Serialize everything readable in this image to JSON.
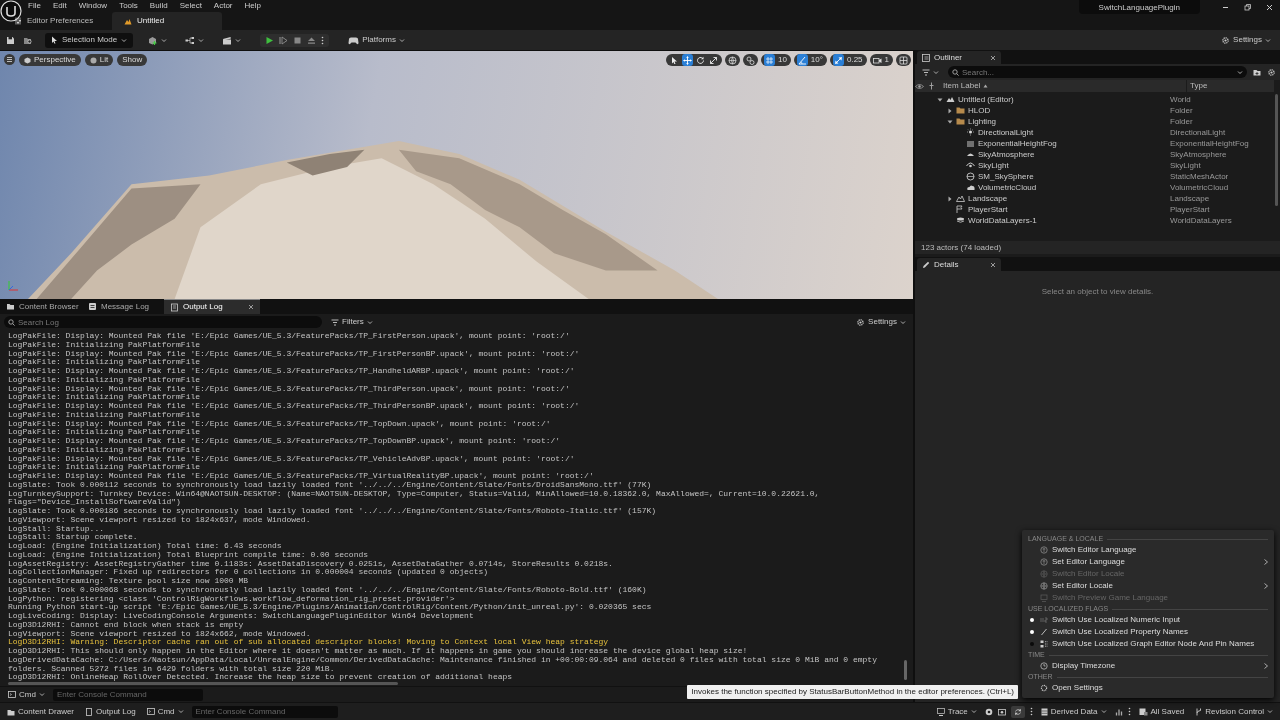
{
  "app": {
    "menus": [
      "File",
      "Edit",
      "Window",
      "Tools",
      "Build",
      "Select",
      "Actor",
      "Help"
    ],
    "tabs": [
      {
        "label": "Editor Preferences",
        "kind": "preferences",
        "selected": false
      },
      {
        "label": "Untitled",
        "kind": "level",
        "selected": true
      }
    ],
    "project": "SwitchLanguagePlugin"
  },
  "toolbar": {
    "mode": "Selection Mode",
    "platforms": "Platforms",
    "settings": "Settings"
  },
  "viewport": {
    "view": "Perspective",
    "lighting": "Lit",
    "show": "Show",
    "tools": [
      {
        "kind": "select",
        "selected": false
      },
      {
        "kind": "move",
        "selected": true
      },
      {
        "kind": "rotate",
        "selected": false
      },
      {
        "kind": "scale",
        "selected": false
      }
    ],
    "grid_snap": "10",
    "angle_snap": "10°",
    "scale_snap": "0.25",
    "camera_speed": "1"
  },
  "outliner": {
    "tab": "Outliner",
    "search": {
      "placeholder": "Search..."
    },
    "columns": [
      "Item Label",
      "Type"
    ],
    "items": [
      {
        "label": "Untitled (Editor)",
        "type": "World",
        "kind": "world",
        "expanded": true,
        "children": [
          {
            "label": "HLOD",
            "type": "Folder",
            "kind": "folder",
            "expanded": false
          },
          {
            "label": "Lighting",
            "type": "Folder",
            "kind": "folder",
            "expanded": true,
            "children": [
              {
                "label": "DirectionalLight",
                "type": "DirectionalLight",
                "kind": "light"
              },
              {
                "label": "ExponentialHeightFog",
                "type": "ExponentialHeightFog",
                "kind": "fog"
              },
              {
                "label": "SkyAtmosphere",
                "type": "SkyAtmosphere",
                "kind": "atmosphere"
              },
              {
                "label": "SkyLight",
                "type": "SkyLight",
                "kind": "skylight"
              },
              {
                "label": "SM_SkySphere",
                "type": "StaticMeshActor",
                "kind": "mesh"
              },
              {
                "label": "VolumetricCloud",
                "type": "VolumetricCloud",
                "kind": "cloud"
              }
            ]
          },
          {
            "label": "Landscape",
            "type": "Landscape",
            "kind": "landscape",
            "expanded": false
          },
          {
            "label": "PlayerStart",
            "type": "PlayerStart",
            "kind": "playerstart"
          },
          {
            "label": "WorldDataLayers-1",
            "type": "WorldDataLayers",
            "kind": "datalayers"
          }
        ]
      }
    ],
    "footer": "123 actors (74 loaded)"
  },
  "details": {
    "tab": "Details",
    "empty_text": "Select an object to view details."
  },
  "bottom_panel": {
    "tabs": [
      {
        "label": "Content Browser",
        "kind": "content",
        "selected": false
      },
      {
        "label": "Message Log",
        "kind": "message",
        "selected": false
      },
      {
        "label": "Output Log",
        "kind": "output",
        "selected": true
      }
    ],
    "search": {
      "placeholder": "Search Log"
    },
    "filters": "Filters",
    "settings": "Settings",
    "lines": [
      {
        "text": "LogPakFile: Display: Mounted Pak file 'E:/Epic Games/UE_5.3/FeaturePacks/TP_FirstPerson.upack', mount point: 'root:/'",
        "kind": "info"
      },
      {
        "text": "LogPakFile: Initializing PakPlatformFile",
        "kind": "info"
      },
      {
        "text": "LogPakFile: Display: Mounted Pak file 'E:/Epic Games/UE_5.3/FeaturePacks/TP_FirstPersonBP.upack', mount point: 'root:/'",
        "kind": "info"
      },
      {
        "text": "LogPakFile: Initializing PakPlatformFile",
        "kind": "info"
      },
      {
        "text": "LogPakFile: Display: Mounted Pak file 'E:/Epic Games/UE_5.3/FeaturePacks/TP_HandheldARBP.upack', mount point: 'root:/'",
        "kind": "info"
      },
      {
        "text": "LogPakFile: Initializing PakPlatformFile",
        "kind": "info"
      },
      {
        "text": "LogPakFile: Display: Mounted Pak file 'E:/Epic Games/UE_5.3/FeaturePacks/TP_ThirdPerson.upack', mount point: 'root:/'",
        "kind": "info"
      },
      {
        "text": "LogPakFile: Initializing PakPlatformFile",
        "kind": "info"
      },
      {
        "text": "LogPakFile: Display: Mounted Pak file 'E:/Epic Games/UE_5.3/FeaturePacks/TP_ThirdPersonBP.upack', mount point: 'root:/'",
        "kind": "info"
      },
      {
        "text": "LogPakFile: Initializing PakPlatformFile",
        "kind": "info"
      },
      {
        "text": "LogPakFile: Display: Mounted Pak file 'E:/Epic Games/UE_5.3/FeaturePacks/TP_TopDown.upack', mount point: 'root:/'",
        "kind": "info"
      },
      {
        "text": "LogPakFile: Initializing PakPlatformFile",
        "kind": "info"
      },
      {
        "text": "LogPakFile: Display: Mounted Pak file 'E:/Epic Games/UE_5.3/FeaturePacks/TP_TopDownBP.upack', mount point: 'root:/'",
        "kind": "info"
      },
      {
        "text": "LogPakFile: Initializing PakPlatformFile",
        "kind": "info"
      },
      {
        "text": "LogPakFile: Display: Mounted Pak file 'E:/Epic Games/UE_5.3/FeaturePacks/TP_VehicleAdvBP.upack', mount point: 'root:/'",
        "kind": "info"
      },
      {
        "text": "LogPakFile: Initializing PakPlatformFile",
        "kind": "info"
      },
      {
        "text": "LogPakFile: Display: Mounted Pak file 'E:/Epic Games/UE_5.3/FeaturePacks/TP_VirtualRealityBP.upack', mount point: 'root:/'",
        "kind": "info"
      },
      {
        "text": "LogSlate: Took 0.000112 seconds to synchronously load lazily loaded font '../../../Engine/Content/Slate/Fonts/DroidSansMono.ttf' (77K)",
        "kind": "info"
      },
      {
        "text": "LogTurnkeySupport: Turnkey Device: Win64@NAOTSUN-DESKTOP: (Name=NAOTSUN-DESKTOP, Type=Computer, Status=Valid, MinAllowed=10.0.18362.0, MaxAllowed=, Current=10.0.22621.0, Flags=\"Device_InstallSoftwareValid\")",
        "kind": "info"
      },
      {
        "text": "LogSlate: Took 0.000186 seconds to synchronously load lazily loaded font '../../../Engine/Content/Slate/Fonts/Roboto-Italic.ttf' (157K)",
        "kind": "info"
      },
      {
        "text": "LogViewport: Scene viewport resized to 1824x637, mode Windowed.",
        "kind": "info"
      },
      {
        "text": "LogStall: Startup...",
        "kind": "info"
      },
      {
        "text": "LogStall: Startup complete.",
        "kind": "info"
      },
      {
        "text": "LogLoad: (Engine Initialization) Total time: 6.43 seconds",
        "kind": "info"
      },
      {
        "text": "LogLoad: (Engine Initialization) Total Blueprint compile time: 0.00 seconds",
        "kind": "info"
      },
      {
        "text": "LogAssetRegistry: AssetRegistryGather time 0.1183s: AssetDataDiscovery 0.0251s, AssetDataGather 0.0714s, StoreResults 0.0218s.",
        "kind": "info"
      },
      {
        "text": "LogCollectionManager: Fixed up redirectors for 0 collections in 0.000004 seconds (updated 0 objects)",
        "kind": "info"
      },
      {
        "text": "LogContentStreaming: Texture pool size now 1000 MB",
        "kind": "info"
      },
      {
        "text": "LogSlate: Took 0.000068 seconds to synchronously load lazily loaded font '../../../Engine/Content/Slate/Fonts/Roboto-Bold.ttf' (160K)",
        "kind": "info"
      },
      {
        "text": "LogPython: registering <class 'ControlRigWorkflows.workflow_deformation_rig_preset.provider'>",
        "kind": "info"
      },
      {
        "text": "Running Python start-up script 'E:/Epic Games/UE_5.3/Engine/Plugins/Animation/ControlRig/Content/Python/init_unreal.py': 0.020365 secs",
        "kind": "info"
      },
      {
        "text": "LogLiveCoding: Display: LiveCodingConsole Arguments: SwitchLanguagePluginEditor Win64 Development",
        "kind": "info"
      },
      {
        "text": "LogD3D12RHI: Cannot end block when stack is empty",
        "kind": "info"
      },
      {
        "text": "LogViewport: Scene viewport resized to 1824x662, mode Windowed.",
        "kind": "info"
      },
      {
        "text": "LogD3D12RHI: Warning: Descriptor cache ran out of sub allocated descriptor blocks! Moving to Context local View heap strategy",
        "kind": "warning"
      },
      {
        "text": "LogD3D12RHI: This should only happen in the Editor where it doesn't matter as much. If it happens in game you should increase the device global heap size!",
        "kind": "info"
      },
      {
        "text": "LogDerivedDataCache: C:/Users/Naotsun/AppData/Local/UnrealEngine/Common/DerivedDataCache: Maintenance finished in +00:00:09.064 and deleted 0 files with total size 0 MiB and 0 empty folders. Scanned 5272 files in 6429 folders with total size 220 MiB.",
        "kind": "info"
      },
      {
        "text": "LogD3D12RHI: OnlineHeap RollOver Detected. Increase the heap size to prevent creation of additional heaps",
        "kind": "info"
      }
    ],
    "console": {
      "mode": "Cmd",
      "placeholder": "Enter Console Command"
    }
  },
  "context_menu": {
    "sections": [
      {
        "heading": "LANGUAGE & LOCALE",
        "items": [
          {
            "label": "Switch Editor Language",
            "kind": "language",
            "disabled": false,
            "submenu": false
          },
          {
            "label": "Set Editor Language",
            "kind": "language",
            "disabled": false,
            "submenu": true
          },
          {
            "label": "Switch Editor Locale",
            "kind": "locale",
            "disabled": true,
            "submenu": false
          },
          {
            "label": "Set Editor Locale",
            "kind": "locale",
            "disabled": false,
            "submenu": true
          },
          {
            "label": "Switch Preview Game Language",
            "kind": "preview",
            "disabled": true,
            "submenu": false
          }
        ]
      },
      {
        "heading": "USE LOCALIZED FLAGS",
        "items": [
          {
            "label": "Switch Use Localized Numeric Input",
            "kind": "numeric",
            "disabled": false,
            "submenu": false,
            "checked": true
          },
          {
            "label": "Switch Use Localized Property Names",
            "kind": "property",
            "disabled": false,
            "submenu": false,
            "checked": true
          },
          {
            "label": "Switch Use Localized Graph Editor Node And Pin Names",
            "kind": "graph",
            "disabled": false,
            "submenu": false,
            "checked": false
          }
        ]
      },
      {
        "heading": "TIME",
        "items": [
          {
            "label": "Display Timezone",
            "kind": "clock",
            "disabled": false,
            "submenu": true
          }
        ]
      },
      {
        "heading": "OTHER",
        "items": [
          {
            "label": "Open Settings",
            "kind": "settings",
            "disabled": false,
            "submenu": false
          }
        ]
      }
    ]
  },
  "tooltip": "Invokes the function specified by StatusBarButtonMethod in the editor preferences. (Ctrl+L)",
  "status_bar": {
    "content_drawer": "Content Drawer",
    "output_log": "Output Log",
    "console": {
      "mode": "Cmd",
      "placeholder": "Enter Console Command"
    },
    "trace": "Trace",
    "derived_data": "Derived Data",
    "save_state": "All Saved",
    "revision_control": "Revision Control"
  }
}
